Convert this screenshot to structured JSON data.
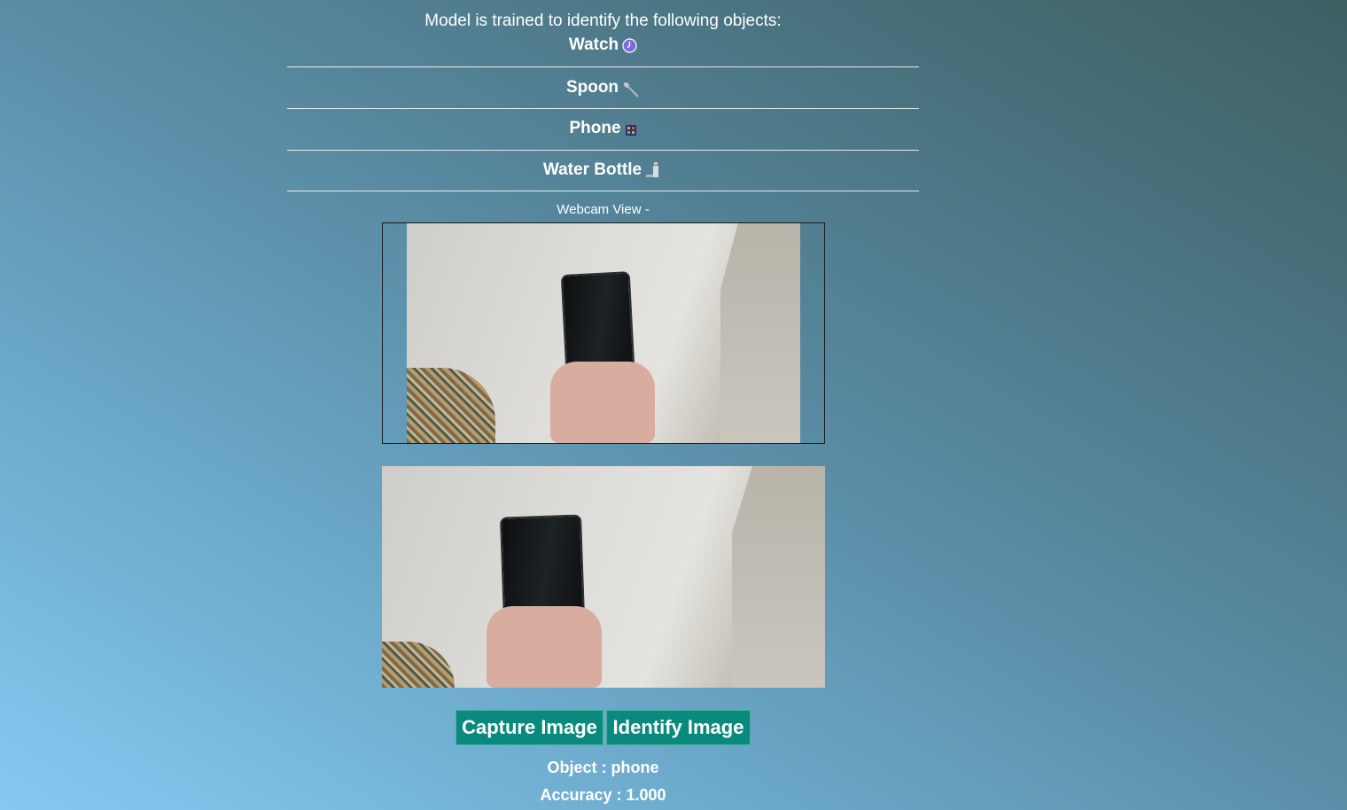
{
  "intro": {
    "text": "Model is trained to identify the following objects:"
  },
  "objects": [
    {
      "label": "Watch",
      "icon": "watch-icon"
    },
    {
      "label": "Spoon",
      "icon": "spoon-icon"
    },
    {
      "label": "Phone",
      "icon": "phone-icon"
    },
    {
      "label": "Water Bottle",
      "icon": "water-bottle-icon"
    }
  ],
  "webcam": {
    "label": "Webcam View -"
  },
  "buttons": {
    "capture": "Capture Image",
    "identify": "Identify Image"
  },
  "result": {
    "object": "Object : phone",
    "accuracy": "Accuracy : 1.000"
  },
  "colors": {
    "button_bg": "#0a8a7d",
    "text": "#ffffff"
  }
}
